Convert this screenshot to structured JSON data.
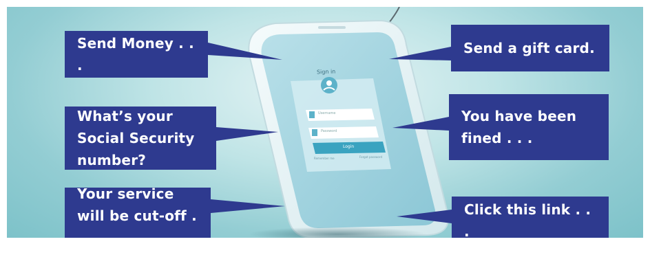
{
  "bubbles": {
    "send_money": "Send Money . . .",
    "social_security": "What’s your Social Security number?",
    "service_cutoff": "Your service will be cut-off . . .",
    "gift_card": "Send a gift card.",
    "fined": "You have been fined . . .",
    "click_link": "Click this link . . ."
  },
  "phone_screen": {
    "title": "Sign in",
    "username_placeholder": "Username",
    "password_placeholder": "Password",
    "login_button": "Login",
    "remember": "Remember me",
    "forgot": "Forgot password"
  },
  "colors": {
    "box": "#2e3a8f",
    "background": "#9fd4d8",
    "accent": "#3aa3c0"
  },
  "icons": [
    "fishing-hook-icon",
    "user-avatar-icon",
    "user-icon",
    "lock-icon"
  ]
}
